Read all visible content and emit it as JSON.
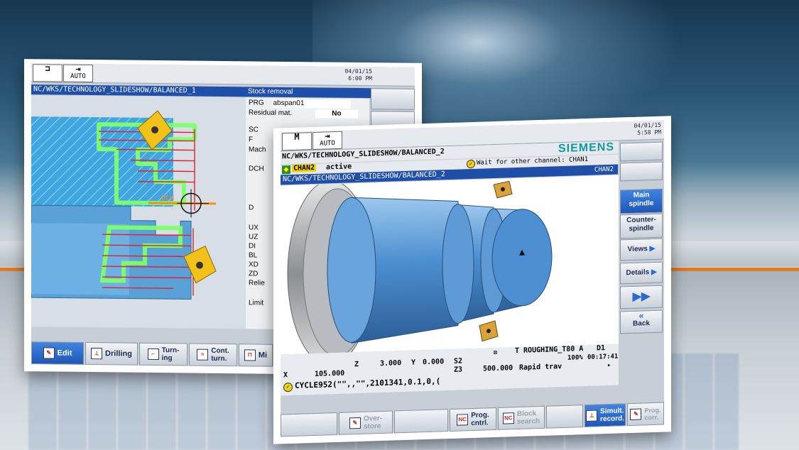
{
  "screen1": {
    "mode_label": "AUTO",
    "date": "04/01/15",
    "time": "6:00 PM",
    "path": "NC/WKS/TECHNOLOGY_SLIDESHOW/BALANCED_1",
    "panel_title": "Stock removal",
    "params": [
      {
        "label": "PRG",
        "value": "abspan01"
      },
      {
        "label": "Residual mat.",
        "value": "No"
      },
      {
        "label": "SC",
        "value": ""
      },
      {
        "label": "F",
        "value": ""
      },
      {
        "label": "Mach",
        "value": ""
      },
      {
        "label": "DCH",
        "value": ""
      },
      {
        "label": "D",
        "value": ""
      },
      {
        "label": "UX",
        "value": ""
      },
      {
        "label": "UZ",
        "value": ""
      },
      {
        "label": "DI",
        "value": ""
      },
      {
        "label": "BL",
        "value": ""
      },
      {
        "label": "XD",
        "value": ""
      },
      {
        "label": "ZD",
        "value": ""
      },
      {
        "label": "Relie",
        "value": ""
      },
      {
        "label": "Limit",
        "value": ""
      }
    ],
    "sim_label": "DCH",
    "hkeys": [
      "Edit",
      "Drilling",
      "Turn-\ning",
      "Cont.\nturn.",
      "Mi"
    ]
  },
  "screen2": {
    "mode_label": "AUTO",
    "date": "04/01/15",
    "time": "5:58 PM",
    "path": "NC/WKS/TECHNOLOGY_SLIDESHOW/BALANCED_2",
    "brand": "SIEMENS",
    "channel": "CHAN2",
    "channel_state": "active",
    "wait_msg": "Wait for other channel: CHAN1",
    "channel_tag": "CHAN2",
    "view_path": "NC/WKS/TECHNOLOGY_SLIDESHOW/BALANCED_2",
    "status": {
      "tool": "T ROUGHING_T80 A",
      "d": "D1",
      "percent": "100%",
      "clock": "00:17:41",
      "s2": "S2",
      "s_value": "0.000",
      "z23": "Z3",
      "feed": "500.000",
      "rapid": "Rapid trav",
      "x_label": "X",
      "x_value": "105.000",
      "z_label": "Z",
      "z_value": "3.000",
      "y_label": "Y",
      "cycle": "CYCLE952(\"\",,\"\",2101341,0.1,0,("
    },
    "vkeys": [
      "Main\nspindle",
      "Counter-\nspindle",
      "Views",
      "Details",
      "",
      "Back"
    ],
    "hkeys": [
      "Over-\nstore",
      "Prog.\ncntrl.",
      "Block\nsearch",
      "Simult.\nrecord.",
      "Prog.\ncorr."
    ]
  },
  "colors": {
    "accent_blue": "#1f4fa8",
    "chan_green": "#2a8f2a",
    "chan_yellow": "#f5d400",
    "part_blue": "#4d8fd0",
    "orange_stripe": "#e07a1f"
  }
}
